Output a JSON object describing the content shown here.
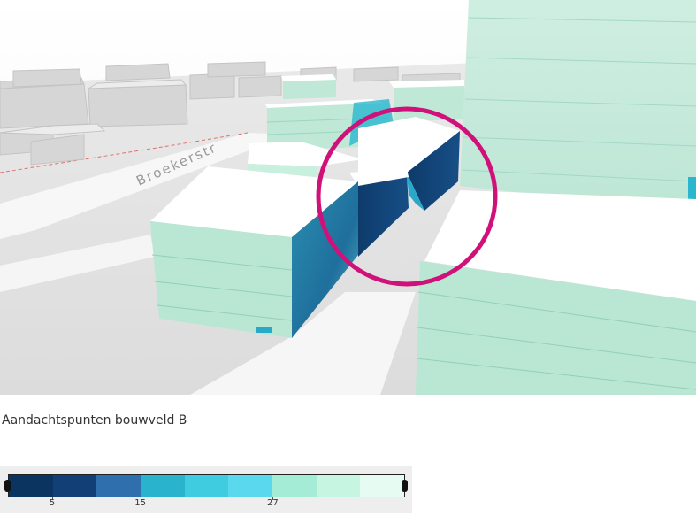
{
  "scene": {
    "street_label": "Broekerstr",
    "highlight_color": "#d0117a"
  },
  "caption": "Aandachtspunten bouwveld B",
  "legend": {
    "colors": [
      "#0b3461",
      "#123f75",
      "#2f6fad",
      "#2ab3cc",
      "#3fcbe0",
      "#5ad9ee",
      "#a4ecd6",
      "#c6f6e2",
      "#e6fcf3"
    ],
    "ticks": [
      {
        "label": "5",
        "slot": 1
      },
      {
        "label": "15",
        "slot": 3
      },
      {
        "label": "27",
        "slot": 6
      }
    ]
  }
}
